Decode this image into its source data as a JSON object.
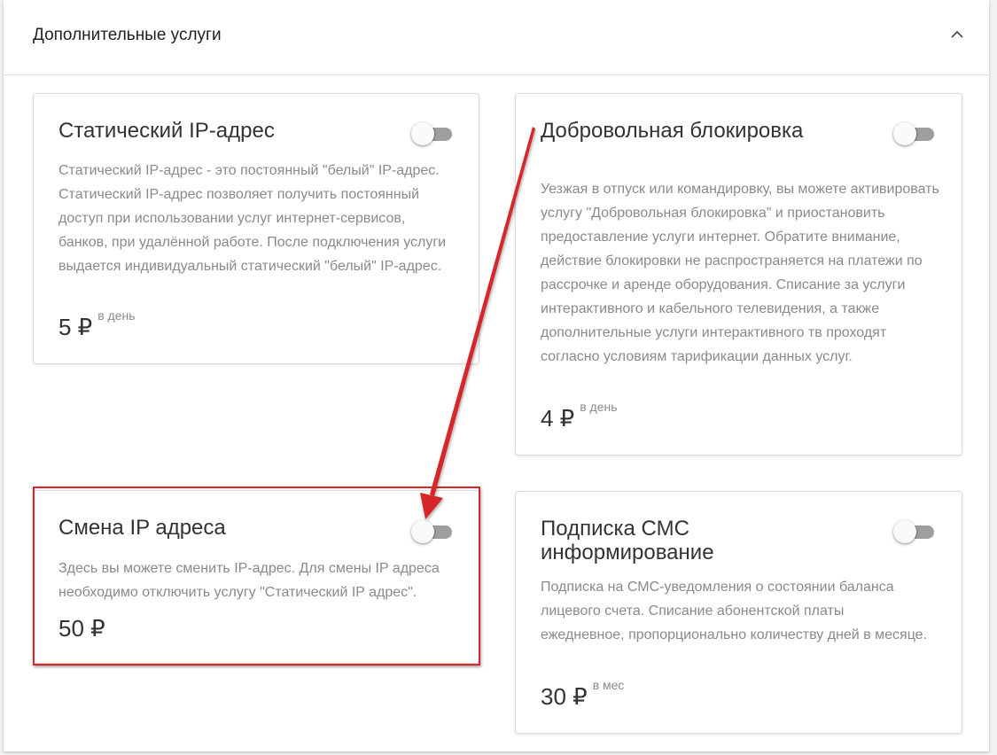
{
  "section": {
    "title": "Дополнительные услуги"
  },
  "services": [
    {
      "title": "Статический IP-адрес",
      "description": "Статический IP-адрес - это постоянный \"белый\" IP-адрес. Статический IP-адрес позволяет получить постоянный доступ при использовании услуг интернет-сервисов, банков, при удалённой работе. После подключения услуги выдается индивидуальный статический \"белый\" IP-адрес.",
      "price": "5 ₽",
      "unit": "в день",
      "enabled": false
    },
    {
      "title": "Добровольная блокировка",
      "description": "Уезжая в отпуск или командировку, вы можете активировать услугу \"Добровольная блокировка\" и приостановить предоставление услуги интернет. Обратите внимание, действие блокировки не распространяется на платежи по рассрочке и аренде оборудования. Списание за услуги интерактивного и кабельного телевидения, а также дополнительные услуги интерактивного тв проходят согласно условиям тарификации данных услуг.",
      "price": "4 ₽",
      "unit": "в день",
      "enabled": false
    },
    {
      "title": "Смена IP адреса",
      "description": "Здесь вы можете сменить IP-адрес. Для смены IP адреса необходимо отключить услугу \"Статический IP адрес\".",
      "price": "50 ₽",
      "unit": "",
      "enabled": false
    },
    {
      "title": "Подписка СМС информирование",
      "description": "Подписка на СМС-уведомления о состоянии баланса лицевого счета. Списание абонентской платы ежедневное, пропорционально количеству дней в месяце.",
      "price": "30 ₽",
      "unit": "в мес",
      "enabled": false
    }
  ],
  "icons": {
    "collapse": "chevron-up-icon"
  },
  "colors": {
    "annotation": "#d7262c",
    "toggle_off_track": "#9e9e9e",
    "toggle_thumb": "#fafafa",
    "title_text": "#333333",
    "muted_text": "#8a8a8a"
  }
}
